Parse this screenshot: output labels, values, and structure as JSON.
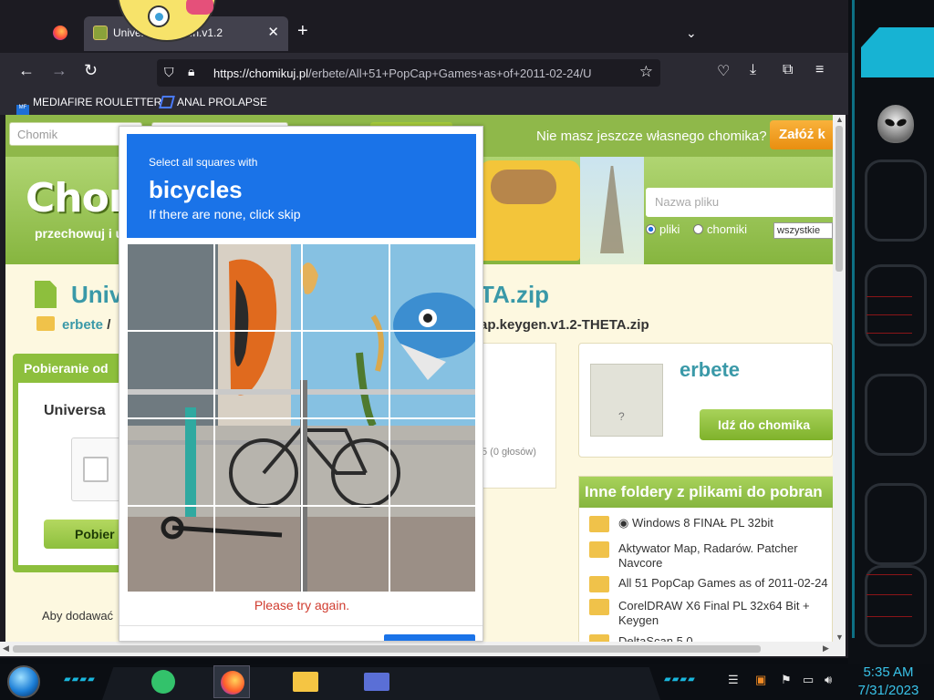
{
  "browser": {
    "tabs": [
      {
        "title": ""
      },
      {
        "title": "Universal.Keygen.v1.2",
        "close": "✕"
      }
    ],
    "new_tab": "+",
    "tab_list": "⌄",
    "nav": {
      "back": "←",
      "forward": "→",
      "reload": "↻"
    },
    "url": {
      "host": "https://chomikuj.pl",
      "path": "/erbete/All+51+PopCap+Games+as+of+2011-02-24/U"
    },
    "bookmarks": [
      {
        "label": "MEDIAFIRE ROULETTER",
        "icon": "mediafire-icon"
      },
      {
        "label": "ANAL PROLAPSE",
        "icon": "anal-icon"
      }
    ]
  },
  "page": {
    "search_placeholder": "Chomik",
    "no_account_text": "Nie masz jeszcze własnego chomika?",
    "signup_button": "Załóż k",
    "logo": "Chom",
    "logo_sub": "przechowuj i u",
    "file_search_placeholder": "Nazwa pliku",
    "radio_files": "pliki",
    "radio_chomiki": "chomiki",
    "filter_select": "wszystkie",
    "file_title_left": "Univ",
    "file_title_right": "TA.zip",
    "crumb_user": "erbete",
    "crumb_sep": "/",
    "crumb_file_right": "ap.keygen.v1.2-THETA.zip",
    "download_box_title": "Pobieranie od",
    "download_file_name": "Universa",
    "download_button": "Pobier",
    "add_note": "Aby dodawać",
    "rating": "5 (0 głosów)",
    "owner_name": "erbete",
    "go_to_chomik_button": "Idź do chomika",
    "other_folders_title": "Inne foldery z plikami do pobran",
    "other_folders": [
      "◉ Windows 8 FINAŁ PL 32bit",
      "Aktywator Map, Radarów. Patcher Navcore",
      "All 51 PopCap Games as of 2011-02-24",
      "CorelDRAW X6 Final PL 32x64 Bit + Keygen",
      "DeltaScan 5.0"
    ]
  },
  "captcha": {
    "instruction_small": "Select all squares with",
    "target_object": "bicycles",
    "instruction_sub": "If there are none, click skip",
    "error": "Please try again.",
    "grid_size": 4
  },
  "taskbar": {
    "time": "5:35 AM",
    "date": "7/31/2023",
    "apps": [
      "notes-app",
      "firefox-app",
      "file-explorer-app",
      "media-app"
    ]
  },
  "colors": {
    "captcha_blue": "#1a73e8",
    "chomik_green": "#8dbf3d",
    "chomik_teal": "#3a99a8",
    "error_red": "#d03c2f"
  }
}
